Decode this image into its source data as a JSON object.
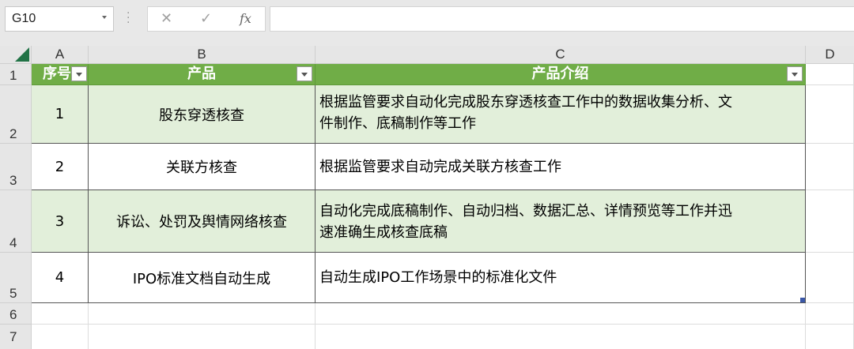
{
  "name_box": {
    "value": "G10"
  },
  "formula_bar": {
    "cancel_glyph": "✕",
    "enter_glyph": "✓",
    "fx_label": "fx",
    "content": ""
  },
  "columns": [
    "A",
    "B",
    "C",
    "D"
  ],
  "rows": [
    "1",
    "2",
    "3",
    "4",
    "5",
    "6",
    "7"
  ],
  "table": {
    "headers": [
      "序号",
      "产品",
      "产品介绍"
    ],
    "rows": [
      {
        "no": "1",
        "product": "股东穿透核查",
        "desc_line1": "根据监管要求自动化完成股东穿透核查工作中的数据收集分析、文",
        "desc_line2": "件制作、底稿制作等工作"
      },
      {
        "no": "2",
        "product": "关联方核查",
        "desc_line1": "根据监管要求自动完成关联方核查工作",
        "desc_line2": ""
      },
      {
        "no": "3",
        "product": "诉讼、处罚及舆情网络核查",
        "desc_line1": "自动化完成底稿制作、自动归档、数据汇总、详情预览等工作并迅",
        "desc_line2": "速准确生成核查底稿"
      },
      {
        "no": "4",
        "product": "IPO标准文档自动生成",
        "desc_line1": "自动生成IPO工作场景中的标准化文件",
        "desc_line2": ""
      }
    ]
  },
  "colors": {
    "header_fill": "#70ad47",
    "band_fill": "#e2efda",
    "excel_green": "#217346"
  }
}
